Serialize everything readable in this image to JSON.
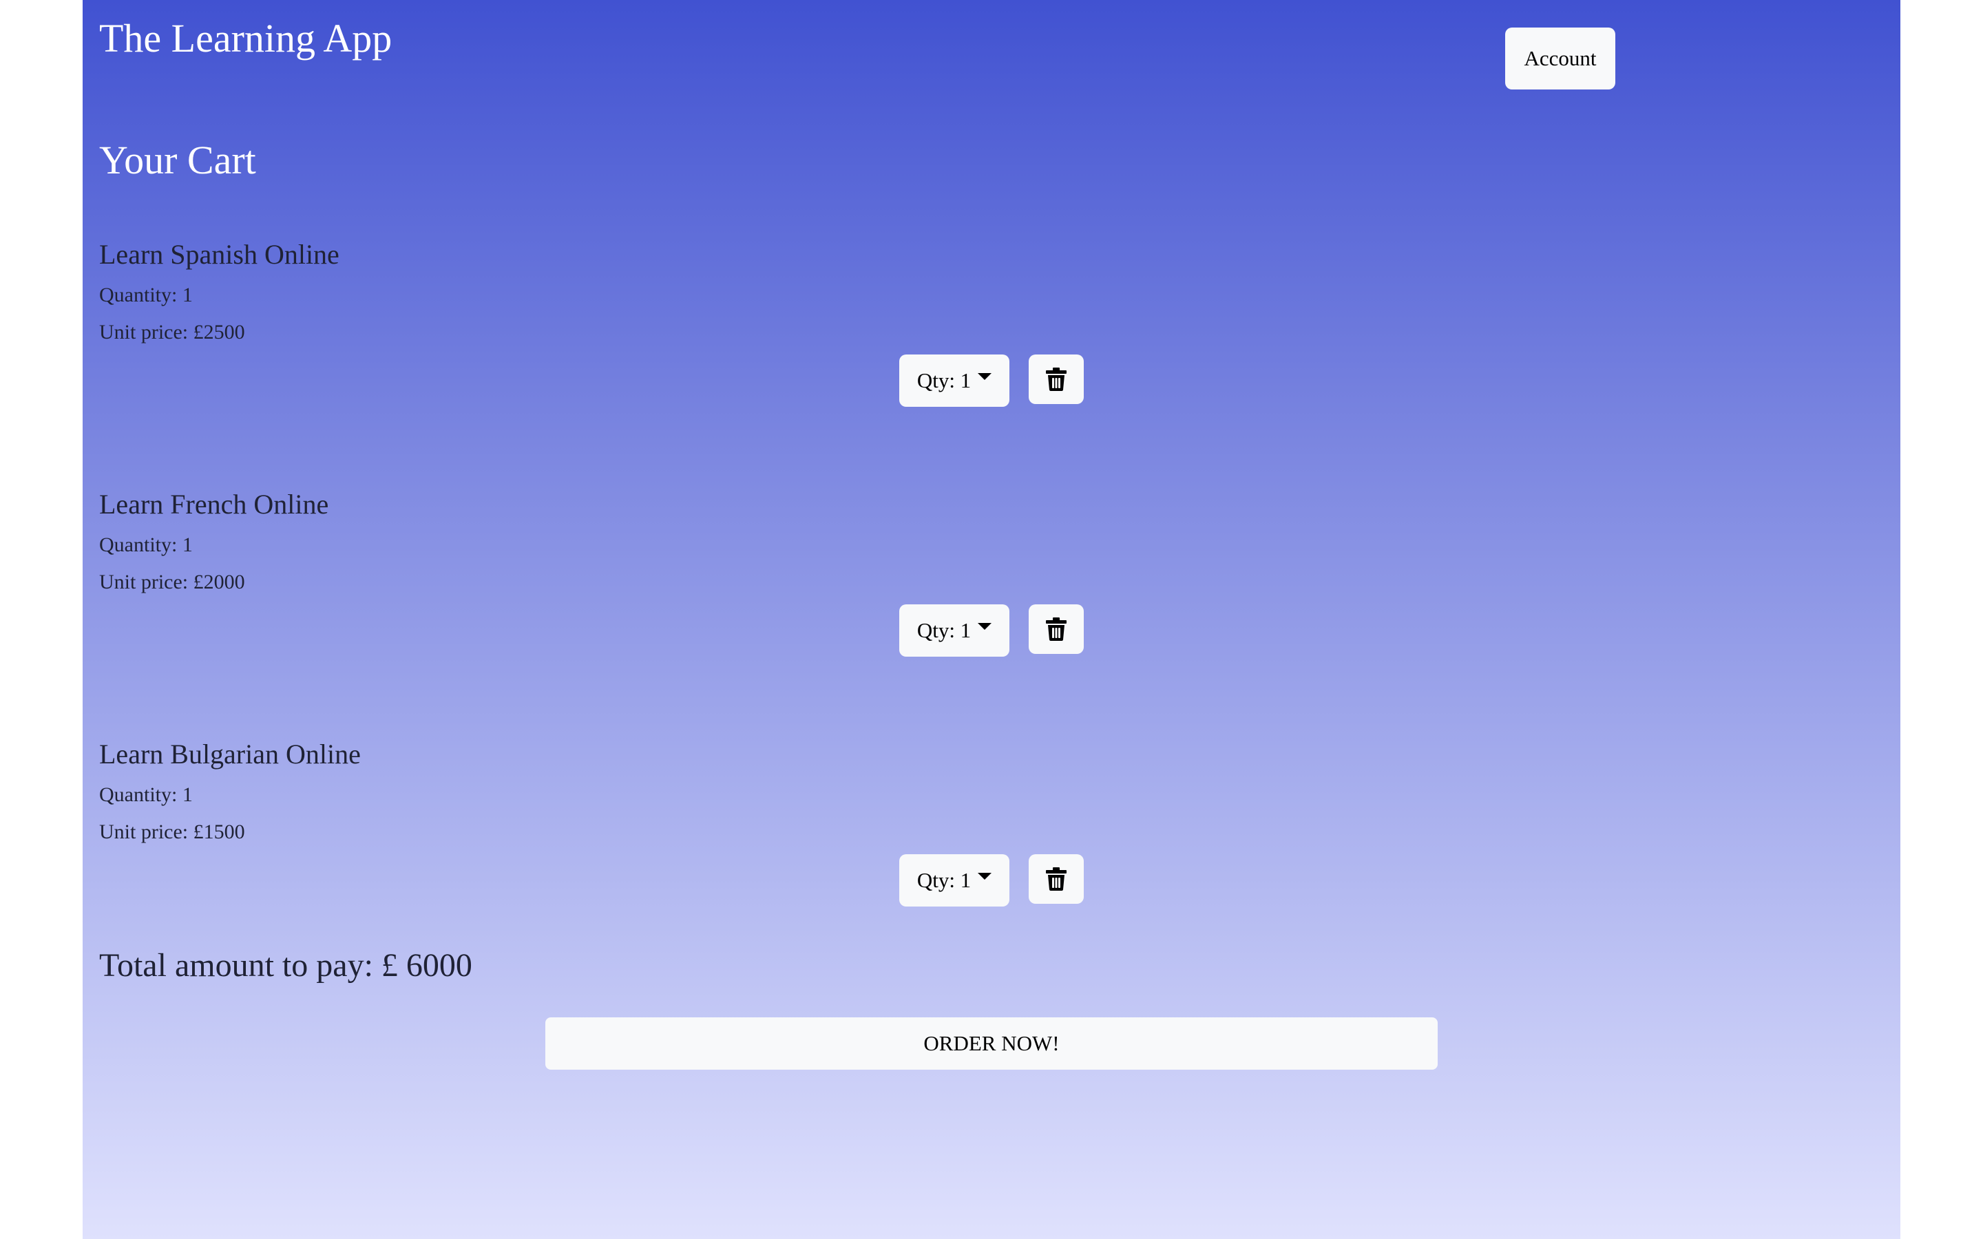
{
  "app": {
    "title": "The Learning App",
    "account_label": "Account"
  },
  "cart": {
    "title": "Your Cart",
    "items": [
      {
        "name": "Learn Spanish Online",
        "quantity_text": "Quantity: 1",
        "unit_price_text": "Unit price: £2500",
        "qty_select_label": "Qty: 1"
      },
      {
        "name": "Learn French Online",
        "quantity_text": "Quantity: 1",
        "unit_price_text": "Unit price: £2000",
        "qty_select_label": "Qty: 1"
      },
      {
        "name": "Learn Bulgarian Online",
        "quantity_text": "Quantity: 1",
        "unit_price_text": "Unit price: £1500",
        "qty_select_label": "Qty: 1"
      }
    ],
    "delete_icon": "trash-icon",
    "total_text": "Total amount to pay: £ 6000",
    "order_label": "ORDER NOW!"
  },
  "colors": {
    "gradient_top": "#4152d1",
    "gradient_bottom": "#dfe1fd",
    "button_bg": "#f8f9fa",
    "header_text": "#ffffff",
    "body_text": "#1f2235"
  }
}
